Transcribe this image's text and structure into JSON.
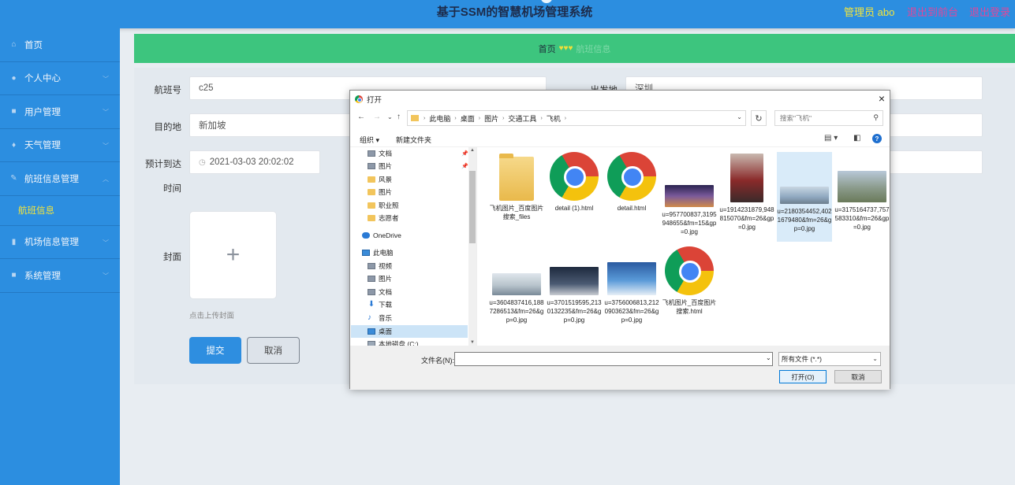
{
  "header": {
    "title": "基于SSM的智慧机场管理系统",
    "admin": "管理员 abo",
    "back_front": "退出到前台",
    "logout": "退出登录"
  },
  "sidebar": {
    "items": [
      {
        "label": "首页",
        "icon": "home-icon"
      },
      {
        "label": "个人中心",
        "icon": "user-icon"
      },
      {
        "label": "用户管理",
        "icon": "clipboard-icon"
      },
      {
        "label": "天气管理",
        "icon": "mic-icon"
      },
      {
        "label": "航班信息管理",
        "icon": "edit-icon"
      },
      {
        "label": "机场信息管理",
        "icon": "chart-icon"
      },
      {
        "label": "系统管理",
        "icon": "clipboard-icon"
      }
    ],
    "sub_item": "航班信息"
  },
  "breadcrumb": {
    "home": "首页",
    "hearts": "♥♥♥",
    "current": "航班信息"
  },
  "form": {
    "flight_no_label": "航班号",
    "flight_no_value": "c25",
    "departure_label": "出发地",
    "departure_value": "深圳",
    "destination_label": "目的地",
    "destination_value": "新加坡",
    "eta_label_1": "预计到达",
    "eta_label_2": "时间",
    "eta_value": "2021-03-03 20:02:02",
    "cover_label": "封面",
    "upload_plus": "+",
    "upload_hint": "点击上传封面",
    "submit": "提交",
    "cancel": "取消"
  },
  "dialog": {
    "title": "打开",
    "close": "×",
    "path": [
      "此电脑",
      "桌面",
      "图片",
      "交通工具",
      "飞机"
    ],
    "search_placeholder": "搜索\"飞机\"",
    "organize": "组织 ▾",
    "new_folder": "新建文件夹",
    "help": "?",
    "tree": [
      {
        "label": "文档",
        "type": "doc",
        "pinned": true
      },
      {
        "label": "图片",
        "type": "doc",
        "pinned": true
      },
      {
        "label": "风景",
        "type": "folder"
      },
      {
        "label": "图片",
        "type": "folder"
      },
      {
        "label": "职业照",
        "type": "folder"
      },
      {
        "label": "志愿者",
        "type": "folder"
      },
      {
        "label": "OneDrive",
        "type": "cloud"
      },
      {
        "label": "此电脑",
        "type": "pc"
      },
      {
        "label": "视频",
        "type": "doc"
      },
      {
        "label": "图片",
        "type": "doc"
      },
      {
        "label": "文档",
        "type": "doc"
      },
      {
        "label": "下载",
        "type": "dl"
      },
      {
        "label": "音乐",
        "type": "music"
      },
      {
        "label": "桌面",
        "type": "pc"
      },
      {
        "label": "本地磁盘 (C:)",
        "type": "disk"
      }
    ],
    "files": [
      {
        "name": "飞机图片_百度图片搜索_files",
        "kind": "folder"
      },
      {
        "name": "detail (1).html",
        "kind": "chrome"
      },
      {
        "name": "detail.html",
        "kind": "chrome"
      },
      {
        "name": "u=957700837,3195948655&fm=15&gp=0.jpg",
        "kind": "photo",
        "color": "#5a4a7a"
      },
      {
        "name": "u=1914231879,948815070&fm=26&gp=0.jpg",
        "kind": "photo-tall",
        "color": "#7a3a3a"
      },
      {
        "name": "u=2180354452,4021679480&fm=26&gp=0.jpg",
        "kind": "photo",
        "color": "#8fa8c0",
        "selected": true
      },
      {
        "name": "u=3175164737,757583310&fm=26&gp=0.jpg",
        "kind": "photo",
        "color": "#9aa8a0"
      },
      {
        "name": "u=3604837416,1887286513&fm=26&gp=0.jpg",
        "kind": "photo",
        "color": "#b8c4cc"
      },
      {
        "name": "u=3701519595,2130132235&fm=26&gp=0.jpg",
        "kind": "photo",
        "color": "#3a4a5e"
      },
      {
        "name": "u=3756006813,2120903623&fm=26&gp=0.jpg",
        "kind": "photo",
        "color": "#3e7cc4"
      },
      {
        "name": "飞机图片_百度图片搜索.html",
        "kind": "chrome"
      }
    ],
    "filename_label": "文件名(N):",
    "filename_value": "",
    "filetype": "所有文件 (*.*)",
    "open": "打开(O)",
    "cancel": "取消"
  },
  "colors": {
    "primary": "#2c8ee0",
    "breadcrumb_bg": "#3dc57e",
    "accent_yellow": "#f5e53a",
    "accent_pink": "#e0479a"
  }
}
